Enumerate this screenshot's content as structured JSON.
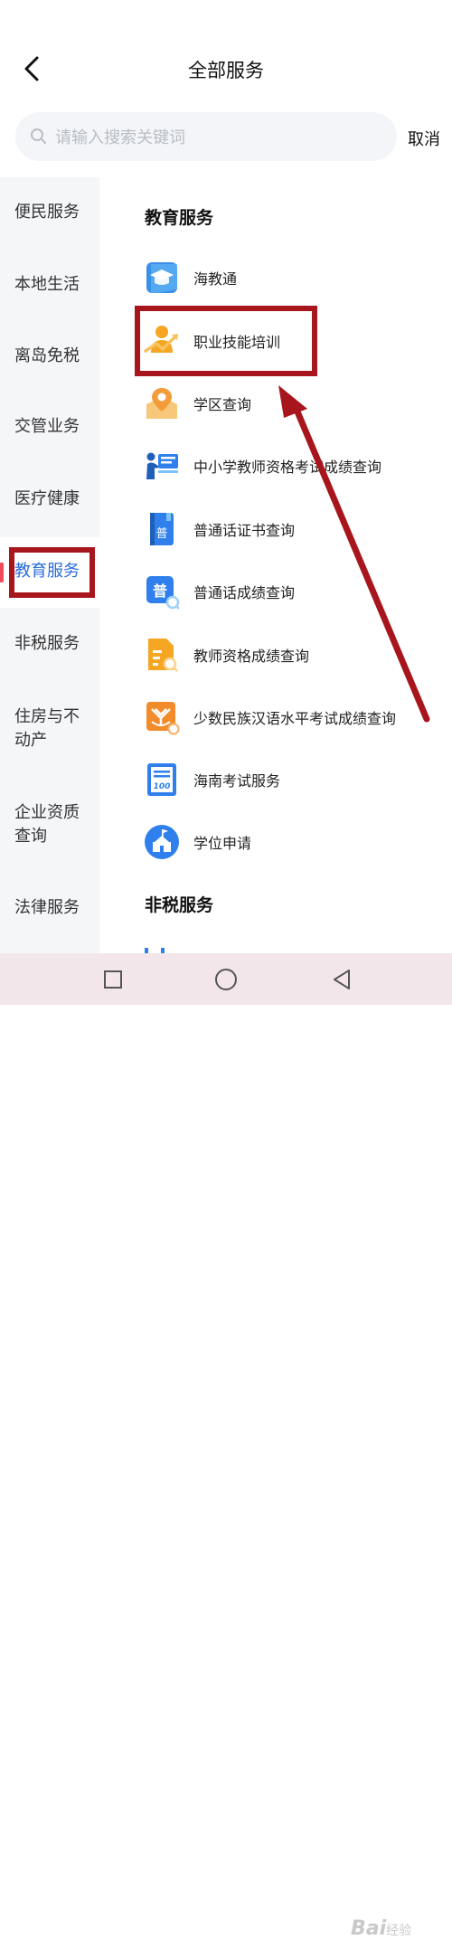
{
  "header": {
    "title": "全部服务",
    "back_icon": "back-arrow-icon"
  },
  "search": {
    "placeholder": "请输入搜索关键词",
    "cancel_label": "取消",
    "icon": "search-icon"
  },
  "sidebar": {
    "items": [
      {
        "label": "便民服务",
        "active": false
      },
      {
        "label": "本地生活",
        "active": false
      },
      {
        "label": "离岛免税",
        "active": false
      },
      {
        "label": "交管业务",
        "active": false
      },
      {
        "label": "医疗健康",
        "active": false
      },
      {
        "label": "教育服务",
        "active": true
      },
      {
        "label": "非税服务",
        "active": false
      },
      {
        "label": "住房与不",
        "label2": "动产",
        "active": false
      },
      {
        "label": "企业资质",
        "label2": "查询",
        "active": false
      },
      {
        "label": "法律服务",
        "active": false
      }
    ]
  },
  "main": {
    "section_title": "教育服务",
    "services": [
      {
        "label": "海教通",
        "icon": "graduation-cap-icon"
      },
      {
        "label": "职业技能培训",
        "icon": "career-growth-icon"
      },
      {
        "label": "学区查询",
        "icon": "map-pin-icon"
      },
      {
        "label": "中小学教师资格考试成绩查询",
        "icon": "teacher-board-icon"
      },
      {
        "label": "普通话证书查询",
        "icon": "certificate-book-icon"
      },
      {
        "label": "普通话成绩查询",
        "icon": "mandarin-score-icon"
      },
      {
        "label": "教师资格成绩查询",
        "icon": "document-search-icon"
      },
      {
        "label": "少数民族汉语水平考试成绩查询",
        "icon": "ethnic-badge-icon"
      },
      {
        "label": "海南考试服务",
        "icon": "exam-paper-icon"
      },
      {
        "label": "学位申请",
        "icon": "school-building-icon"
      }
    ],
    "next_section_title": "非税服务"
  },
  "colors": {
    "accent": "#2a6cd8",
    "annotation": "#a8161d",
    "active_marker": "#f04b5a"
  },
  "watermark": {
    "brand": "Bai",
    "brand2": "经验"
  }
}
